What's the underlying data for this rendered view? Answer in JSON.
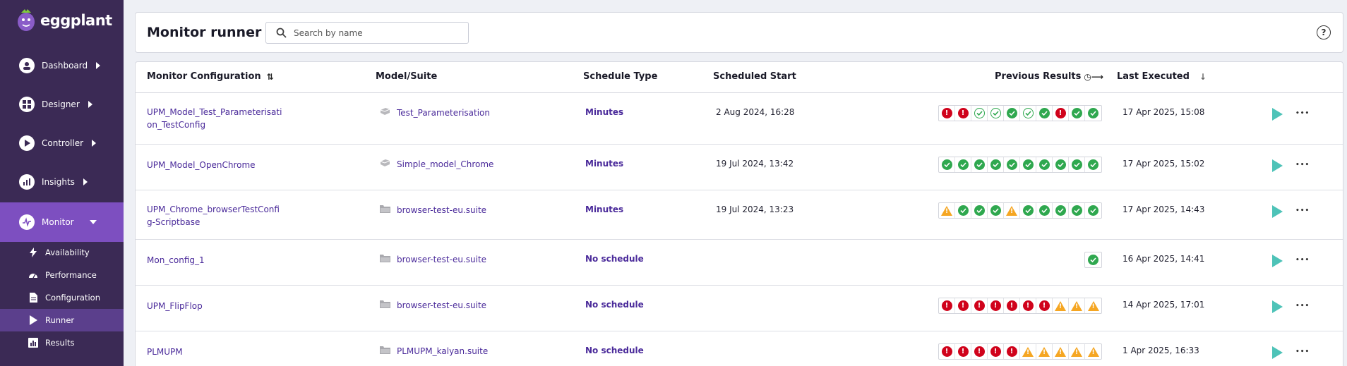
{
  "brand": {
    "name": "eggplant"
  },
  "sidebar": {
    "items": [
      {
        "label": "Dashboard",
        "icon": "dashboard-icon"
      },
      {
        "label": "Designer",
        "icon": "designer-icon"
      },
      {
        "label": "Controller",
        "icon": "controller-icon"
      },
      {
        "label": "Insights",
        "icon": "insights-icon"
      },
      {
        "label": "Monitor",
        "icon": "monitor-icon",
        "expanded": true
      }
    ],
    "sub_items": [
      {
        "label": "Availability",
        "icon": "lightning-icon"
      },
      {
        "label": "Performance",
        "icon": "gauge-icon"
      },
      {
        "label": "Configuration",
        "icon": "document-icon"
      },
      {
        "label": "Runner",
        "icon": "play-icon",
        "active": true
      },
      {
        "label": "Results",
        "icon": "bar-chart-icon"
      }
    ]
  },
  "header": {
    "title": "Monitor runner",
    "search_placeholder": "Search by name",
    "help": "?"
  },
  "table": {
    "columns": {
      "config": "Monitor Configuration",
      "model": "Model/Suite",
      "schedule": "Schedule Type",
      "start": "Scheduled Start",
      "previous": "Previous Results",
      "executed": "Last Executed"
    },
    "rows": [
      {
        "config": "UPM_Model_Test_Parameterisation_TestConfig",
        "model": "Test_Parameterisation",
        "model_type": "model",
        "schedule": "Minutes",
        "start": "2 Aug 2024, 16:28",
        "results": [
          "err",
          "err",
          "okp",
          "okp",
          "ok",
          "okp",
          "ok",
          "err",
          "ok",
          "ok"
        ],
        "executed": "17 Apr 2025, 15:08"
      },
      {
        "config": "UPM_Model_OpenChrome",
        "model": "Simple_model_Chrome",
        "model_type": "model",
        "schedule": "Minutes",
        "start": "19 Jul 2024, 13:42",
        "results": [
          "ok",
          "ok",
          "ok",
          "ok",
          "ok",
          "ok",
          "ok",
          "ok",
          "ok",
          "ok"
        ],
        "executed": "17 Apr 2025, 15:02"
      },
      {
        "config": "UPM_Chrome_browserTestConfig-Scriptbase",
        "model": "browser-test-eu.suite",
        "model_type": "suite",
        "schedule": "Minutes",
        "start": "19 Jul 2024, 13:23",
        "results": [
          "warn",
          "ok",
          "ok",
          "ok",
          "warn",
          "ok",
          "ok",
          "ok",
          "ok",
          "ok"
        ],
        "executed": "17 Apr 2025, 14:43"
      },
      {
        "config": "Mon_config_1",
        "model": "browser-test-eu.suite",
        "model_type": "suite",
        "schedule": "No schedule",
        "start": "",
        "results": [
          "ok"
        ],
        "executed": "16 Apr 2025, 14:41"
      },
      {
        "config": "UPM_FlipFlop",
        "model": "browser-test-eu.suite",
        "model_type": "suite",
        "schedule": "No schedule",
        "start": "",
        "results": [
          "err",
          "err",
          "err",
          "err",
          "err",
          "err",
          "err",
          "warn",
          "warn",
          "warn"
        ],
        "executed": "14 Apr 2025, 17:01"
      },
      {
        "config": "PLMUPM",
        "model": "PLMUPM_kalyan.suite",
        "model_type": "suite",
        "schedule": "No schedule",
        "start": "",
        "results": [
          "err",
          "err",
          "err",
          "err",
          "err",
          "warn",
          "warn",
          "warn",
          "warn",
          "warn"
        ],
        "executed": "1 Apr 2025, 16:33"
      }
    ]
  },
  "colors": {
    "sidebar_bg": "#3b2a55",
    "sidebar_active": "#7d4fc0",
    "sub_active": "#5b3f8c",
    "link": "#4a2a9a",
    "success": "#2fa84f",
    "error": "#d0021b",
    "warning": "#f5a623",
    "play": "#4ec3b8"
  }
}
